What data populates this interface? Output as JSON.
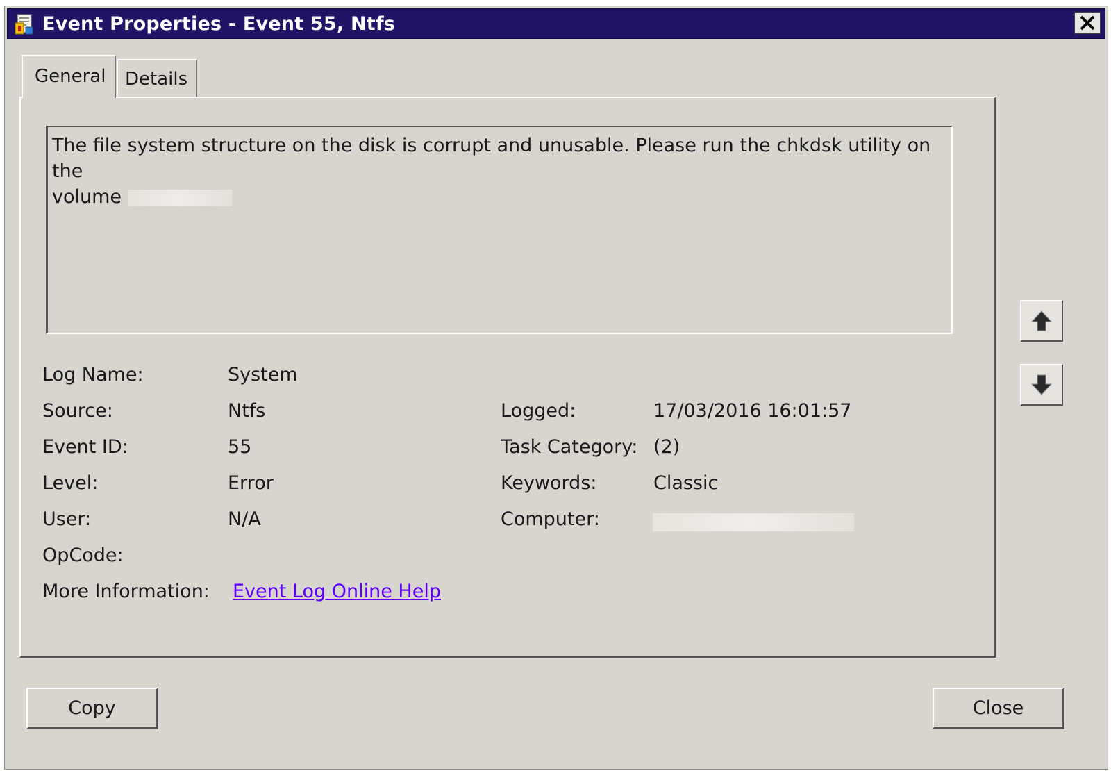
{
  "window": {
    "title": "Event Properties - Event 55, Ntfs",
    "close_glyph": "✕",
    "icon": "event-viewer-icon"
  },
  "tabs": [
    {
      "label": "General",
      "selected": true
    },
    {
      "label": "Details",
      "selected": false
    }
  ],
  "description": {
    "text_line1": "The file system structure on the disk is corrupt and unusable. Please run the chkdsk utility on the",
    "text_line2": "volume"
  },
  "fields": {
    "log_name": {
      "label": "Log Name:",
      "value": "System"
    },
    "source": {
      "label": "Source:",
      "value": "Ntfs"
    },
    "event_id": {
      "label": "Event ID:",
      "value": "55"
    },
    "level": {
      "label": "Level:",
      "value": "Error"
    },
    "user": {
      "label": "User:",
      "value": "N/A"
    },
    "opcode": {
      "label": "OpCode:",
      "value": ""
    },
    "more_info": {
      "label": "More Information:",
      "link_text": "Event Log Online Help"
    },
    "logged": {
      "label": "Logged:",
      "value": "17/03/2016 16:01:57"
    },
    "task_category": {
      "label": "Task Category:",
      "value": "(2)"
    },
    "keywords": {
      "label": "Keywords:",
      "value": "Classic"
    },
    "computer": {
      "label": "Computer:",
      "value": ""
    }
  },
  "nav": {
    "up_icon": "arrow-up-icon",
    "down_icon": "arrow-down-icon"
  },
  "buttons": {
    "copy": "Copy",
    "close": "Close"
  },
  "colors": {
    "titlebar": "#211466",
    "window_bg": "#d8d4ce",
    "link": "#5d00ff"
  }
}
